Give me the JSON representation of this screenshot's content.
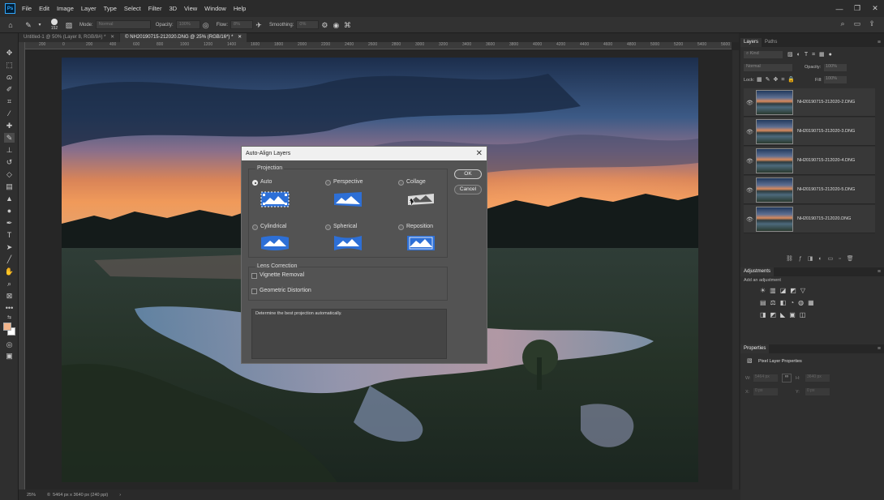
{
  "menu": {
    "app_icon": "Ps",
    "items": [
      "File",
      "Edit",
      "Image",
      "Layer",
      "Type",
      "Select",
      "Filter",
      "3D",
      "View",
      "Window",
      "Help"
    ]
  },
  "options_bar": {
    "brush_size": "152",
    "mode_label": "Mode:",
    "mode_value": "Normal",
    "opacity_label": "Opacity:",
    "opacity_value": "100%",
    "flow_label": "Flow:",
    "flow_value": "8%",
    "smoothing_label": "Smoothing:",
    "smoothing_value": "0%"
  },
  "tabs": [
    {
      "label": "Untitled-1 @ 50% (Layer 8, RGB/8#) *",
      "active": false
    },
    {
      "label": "© NH20190715-212020.DNG @ 25% (RGB/16*) *",
      "active": true
    }
  ],
  "ruler_ticks": [
    "200",
    "0",
    "200",
    "400",
    "600",
    "800",
    "1000",
    "1200",
    "1400",
    "1600",
    "1800",
    "2000",
    "2200",
    "2400",
    "2600",
    "2800",
    "3000",
    "3200",
    "3400",
    "3600",
    "3800",
    "4000",
    "4200",
    "4400",
    "4600",
    "4800",
    "5000",
    "5200",
    "5400",
    "5600"
  ],
  "status": {
    "zoom": "25%",
    "doc_info": "5464 px x 3640 px (240 ppi)"
  },
  "dialog": {
    "title": "Auto-Align Layers",
    "projection_label": "Projection",
    "options": [
      {
        "label": "Auto",
        "selected": true
      },
      {
        "label": "Perspective",
        "selected": false
      },
      {
        "label": "Collage",
        "selected": false
      },
      {
        "label": "Cylindrical",
        "selected": false
      },
      {
        "label": "Spherical",
        "selected": false
      },
      {
        "label": "Reposition",
        "selected": false
      }
    ],
    "lens_label": "Lens Correction",
    "vignette_label": "Vignette Removal",
    "geometric_label": "Geometric Distortion",
    "description": "Determine the best projection automatically.",
    "ok_label": "OK",
    "cancel_label": "Cancel"
  },
  "layers_panel": {
    "tabs": [
      "Layers",
      "Paths"
    ],
    "kind_label": "Kind",
    "blend_mode": "Normal",
    "opacity_label": "Opacity:",
    "opacity_value": "100%",
    "lock_label": "Lock:",
    "fill_label": "Fill:",
    "fill_value": "100%",
    "layers": [
      "NH20190715-212020-2.DNG",
      "NH20190715-212020-3.DNG",
      "NH20190715-212020-4.DNG",
      "NH20190715-212020-5.DNG",
      "NH20190715-212020.DNG"
    ]
  },
  "adjustments_panel": {
    "title": "Adjustments",
    "subtitle": "Add an adjustment"
  },
  "properties_panel": {
    "title": "Properties",
    "subtitle": "Pixel Layer Properties",
    "w_label": "W:",
    "w_value": "5464 px",
    "h_label": "H:",
    "h_value": "3640 px",
    "x_label": "X:",
    "x_value": "0 px",
    "y_label": "Y:",
    "y_value": "0 px"
  },
  "colors": {
    "accent": "#31a8ff",
    "foreground_swatch": "#f2b48a",
    "background_swatch": "#ffffff"
  }
}
